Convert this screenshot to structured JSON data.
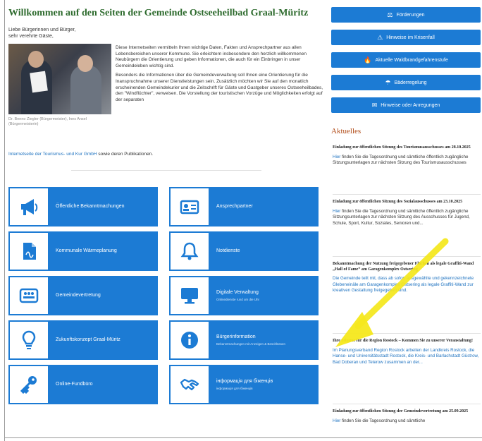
{
  "page": {
    "title": "Willkommen auf den Seiten der Gemeinde Ostseeheilbad Graal-Müritz",
    "greeting_line1": "Liebe Bürgerinnen und Bürger,",
    "greeting_line2": "sehr verehrte Gäste,",
    "photo_caption": "Dr. Benno Ziegler (Bürgermeister), Ines Ansel (Bürgermeisterin)",
    "paragraph1": "Diese Internetseiten vermitteln Ihnen wichtige Daten, Fakten und Ansprechpartner aus allen Lebensbereichen unserer Kommune. Sie erleichtern insbesondere den herzlich willkommenen Neubürgern die Orientierung und geben Informationen, die auch für ein Einbringen in unser Gemeindeleben wichtig sind.",
    "paragraph2": "Besonders die Informationen über die Gemeindeverwaltung soll Ihnen eine Orientierung für die Inanspruchnahme unserer Dienstleistungen sein. Zusätzlich möchten wir Sie auf den monatlich erscheinenden Gemeindekurier und die Zeitschrift für Gäste und Gastgeber unseres Ostseeheilbades, den \"Windflüchter\", verweisen. Die Vorstellung der touristischen Vorzüge und Möglichkeiten erfolgt auf der separaten",
    "link_text": "Internetseite der Tourismus- und Kur GmbH",
    "link_suffix": " sowie deren Publikationen."
  },
  "tiles": [
    {
      "label": "Öffentliche Bekanntmachungen",
      "sub": "",
      "icon": "megaphone-icon"
    },
    {
      "label": "Ansprechpartner",
      "sub": "",
      "icon": "contact-card-icon"
    },
    {
      "label": "Kommunale Wärmeplanung",
      "sub": "",
      "icon": "document-icon"
    },
    {
      "label": "Notdienste",
      "sub": "",
      "icon": "bell-icon"
    },
    {
      "label": "Gemeindevertretung",
      "sub": "",
      "icon": "meeting-icon"
    },
    {
      "label": "Digitale Verwaltung",
      "sub": "Onlinedienste rund um die Uhr",
      "icon": "monitor-icon"
    },
    {
      "label": "Zukunftskonzept Graal-Müritz",
      "sub": "",
      "icon": "lightbulb-icon"
    },
    {
      "label": "Bürgerinformation",
      "sub": "Bekanntmachungen mit Anzeigen & Beschlüssen",
      "icon": "info-icon"
    },
    {
      "label": "Online-Fundbüro",
      "sub": "",
      "icon": "key-icon"
    },
    {
      "label": "інформація для біженців",
      "sub": "інформація для біженців",
      "icon": "handshake-icon"
    }
  ],
  "sidebar": {
    "buttons": [
      {
        "label": "Förderungen",
        "icon": "⚖"
      },
      {
        "label": "Hinweise im Krisenfall",
        "icon": "⚠"
      },
      {
        "label": "Aktuelle Waldbrandgefahrenstufe",
        "icon": "🔥"
      },
      {
        "label": "Bäderregelung",
        "icon": "☂"
      },
      {
        "label": "Hinweise oder Anregungen",
        "icon": "✉"
      }
    ],
    "aktuelles_heading": "Aktuelles",
    "news": [
      {
        "heading": "Einladung zur öffentlichen Sitzung des Tourismusausschusses am 28.10.2025",
        "link": "Hier",
        "text": " finden Sie die Tagesordnung und sämtliche öffentlich zugängliche Sitzungsunterlagen zur nächsten Sitzung des Tourismusausschusses"
      },
      {
        "heading": "Einladung zur öffentlichen Sitzung des Sozialausschusses am 23.10.2025",
        "link": "Hier",
        "text": " finden Sie die Tagesordnung und sämtliche öffentlich zugängliche Sitzungsunterlagen zur nächsten Sitzung des Ausschusses für Jugend, Schule, Sport, Kultur, Soziales, Senioren und..."
      },
      {
        "heading": "Bekanntmachung der Nutzung freigegebener Flächen als legale Graffiti-Wand „Hall of Fame“ am Garagenkomplex Ostsering",
        "link": "",
        "text": "Die Gemeinde teilt mit, dass ab sofort ausgewählte und gekennzeichnete Glebeneinäle am Garagenkomplex Ostsering als legale Graffiti-Wand zur kreativen Gestaltung freigegeben sind."
      },
      {
        "heading": "Ihre Stimme für die Region Rostock – Kommen Sie zu unserer Veranstaltung!",
        "link": "",
        "text": "Im Planungsverband Region Rostock arbeiten der Landkreis Rostock, die Hanse- und Universitätsstadt Rostock, die Kreis- und Barlachstadt Güstrow, Bad Doberan und Teterow zusammen an der..."
      },
      {
        "heading": "Einladung zur öffentlichen Sitzung der Gemeindevertretung am 25.09.2025",
        "link": "Hier",
        "text": " finden Sie die Tagesordnung und sämtliche"
      }
    ]
  },
  "colors": {
    "accent": "#1c7bd4",
    "title_green": "#2e6b2e",
    "aktuelles_orange": "#b04a16",
    "link_blue": "#1f73c0",
    "arrow_yellow": "#f5e81c"
  }
}
